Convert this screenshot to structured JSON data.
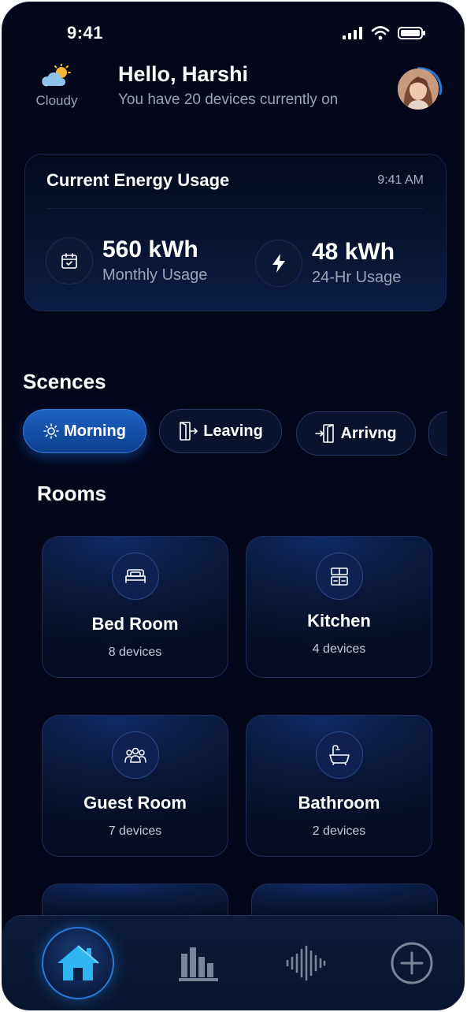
{
  "status": {
    "time": "9:41"
  },
  "header": {
    "weather": {
      "label": "Cloudy",
      "icon": "cloudy-sun-icon"
    },
    "greeting": "Hello, Harshi",
    "subtitle": "You have 20 devices currently on"
  },
  "energy": {
    "title": "Current Energy Usage",
    "time": "9:41 AM",
    "monthly": {
      "value": "560 kWh",
      "label": "Monthly Usage",
      "icon": "calendar-icon"
    },
    "daily": {
      "value": "48 kWh",
      "label": "24-Hr Usage",
      "icon": "lightning-icon"
    }
  },
  "scenes": {
    "title": "Scences",
    "items": [
      {
        "label": "Morning",
        "icon": "sun-icon",
        "active": true
      },
      {
        "label": "Leaving",
        "icon": "door-exit-icon",
        "active": false
      },
      {
        "label": "Arrivng",
        "icon": "door-enter-icon",
        "active": false
      }
    ]
  },
  "rooms": {
    "title": "Rooms",
    "items": [
      {
        "name": "Bed Room",
        "count": "8 devices",
        "icon": "bed-icon"
      },
      {
        "name": "Kitchen",
        "count": "4 devices",
        "icon": "kitchen-icon"
      },
      {
        "name": "Guest Room",
        "count": "7 devices",
        "icon": "people-icon"
      },
      {
        "name": "Bathroom",
        "count": "2 devices",
        "icon": "bathtub-icon"
      }
    ]
  },
  "nav": {
    "items": [
      "home-icon",
      "bar-chart-icon",
      "sound-wave-icon",
      "plus-circle-icon"
    ],
    "active": "home-icon"
  },
  "colors": {
    "background": "#04061a",
    "accent": "#2a7bd6",
    "text_muted": "#9aa3b8"
  }
}
